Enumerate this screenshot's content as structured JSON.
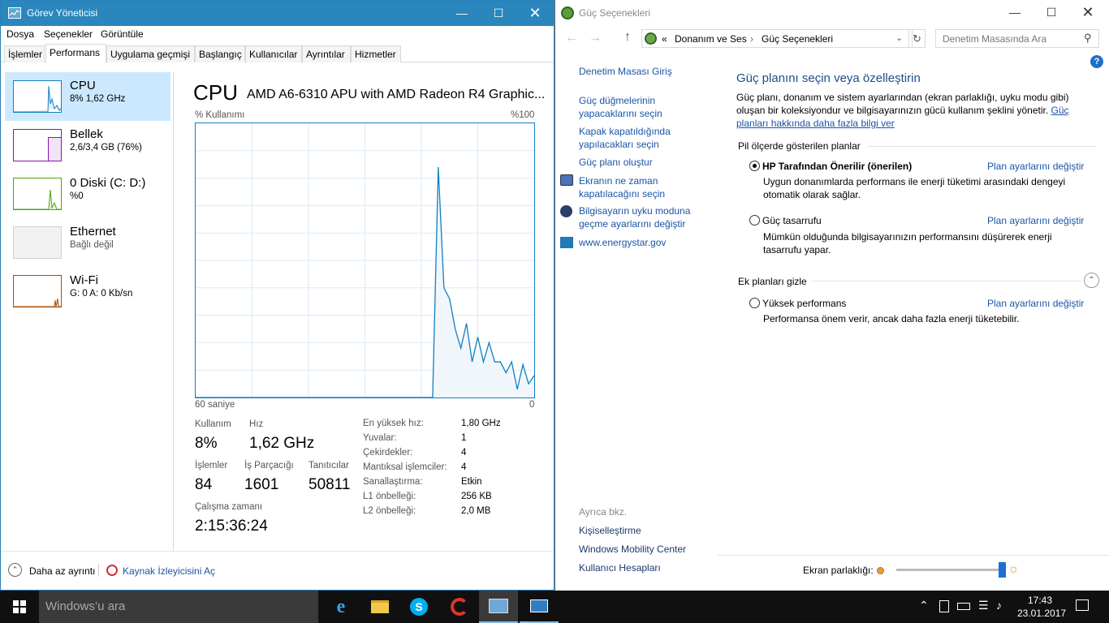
{
  "task_manager": {
    "title": "Görev Yöneticisi",
    "menu": [
      "Dosya",
      "Seçenekler",
      "Görüntüle"
    ],
    "tabs": [
      "İşlemler",
      "Performans",
      "Uygulama geçmişi",
      "Başlangıç",
      "Kullanıcılar",
      "Ayrıntılar",
      "Hizmetler"
    ],
    "active_tab": "Performans",
    "side_items": [
      {
        "name": "CPU",
        "sub": "8% 1,62 GHz",
        "color": "#1180c0"
      },
      {
        "name": "Bellek",
        "sub": "2,6/3,4 GB (76%)",
        "color": "#8b12ae"
      },
      {
        "name": "0 Diski (C: D:)",
        "sub": "%0",
        "color": "#4da60c"
      },
      {
        "name": "Ethernet",
        "sub": "Bağlı değil",
        "color": "#a0a0a0"
      },
      {
        "name": "Wi-Fi",
        "sub": "G: 0 A: 0 Kb/sn",
        "color": "#a74f01"
      }
    ],
    "header": {
      "title": "CPU",
      "model": "AMD A6-6310 APU with AMD Radeon R4 Graphic..."
    },
    "graph": {
      "label_left": "% Kullanımı",
      "label_right": "%100",
      "x_left": "60 saniye",
      "x_right": "0"
    },
    "stats": {
      "usage_label": "Kullanım",
      "usage_value": "8%",
      "speed_label": "Hız",
      "speed_value": "1,62 GHz",
      "processes_label": "İşlemler",
      "processes_value": "84",
      "threads_label": "İş Parçacığı",
      "threads_value": "1601",
      "handles_label": "Tanıtıcılar",
      "handles_value": "50811",
      "uptime_label": "Çalışma zamanı",
      "uptime_value": "2:15:36:24"
    },
    "details": [
      {
        "label": "En yüksek hız:",
        "value": "1,80 GHz"
      },
      {
        "label": "Yuvalar:",
        "value": "1"
      },
      {
        "label": "Çekirdekler:",
        "value": "4"
      },
      {
        "label": "Mantıksal işlemciler:",
        "value": "4"
      },
      {
        "label": "Sanallaştırma:",
        "value": "Etkin"
      },
      {
        "label": "L1 önbelleği:",
        "value": "256 KB"
      },
      {
        "label": "L2 önbelleği:",
        "value": "2,0 MB"
      }
    ],
    "footer": {
      "less_details": "Daha az ayrıntı",
      "resource_monitor": "Kaynak İzleyicisini Aç"
    }
  },
  "chart_data": {
    "type": "area",
    "xlabel": "60 saniye",
    "ylabel": "% Kullanımı",
    "ylim": [
      0,
      100
    ],
    "x": [
      0,
      1,
      2,
      3,
      4,
      5,
      6,
      7,
      8,
      9,
      10,
      11,
      12,
      13,
      14,
      15,
      16,
      17,
      18,
      19,
      20,
      21,
      22,
      23,
      24,
      25,
      26,
      27,
      28,
      29,
      30,
      31,
      32,
      33,
      34,
      35,
      36,
      37,
      38,
      39,
      40,
      41,
      42,
      43,
      44,
      45,
      46,
      47,
      48,
      49,
      50,
      51,
      52,
      53,
      54,
      55,
      56,
      57,
      58,
      59,
      60
    ],
    "values": [
      0,
      0,
      0,
      0,
      0,
      0,
      0,
      0,
      0,
      0,
      0,
      0,
      0,
      0,
      0,
      0,
      0,
      0,
      0,
      0,
      0,
      0,
      0,
      0,
      0,
      0,
      0,
      0,
      0,
      0,
      0,
      0,
      0,
      0,
      0,
      0,
      0,
      0,
      0,
      0,
      0,
      0,
      0,
      84,
      40,
      36,
      25,
      18,
      27,
      13,
      22,
      13,
      20,
      13,
      13,
      9,
      13,
      3,
      12,
      5,
      8
    ],
    "color": "#1180c0"
  },
  "power_options": {
    "title": "Güç Seçenekleri",
    "breadcrumb": [
      "«",
      "Donanım ve Ses",
      "Güç Seçenekleri"
    ],
    "search_placeholder": "Denetim Masasında Ara",
    "sidebar_links": [
      "Denetim Masası Giriş",
      "Güç düğmelerinin yapacaklarını seçin",
      "Kapak kapatıldığında yapılacakları seçin",
      "Güç planı oluştur",
      "Ekranın ne zaman kapatılacağını seçin",
      "Bilgisayarın uyku moduna geçme ayarlarını değiştir",
      "www.energystar.gov"
    ],
    "see_also": "Ayrıca bkz.",
    "see_also_links": [
      "Kişiselleştirme",
      "Windows Mobility Center",
      "Kullanıcı Hesapları"
    ],
    "heading": "Güç planını seçin veya özelleştirin",
    "intro": "Güç planı, donanım ve sistem ayarlarından (ekran parlaklığı, uyku modu gibi) oluşan bir koleksiyondur ve bilgisayarınızın gücü kullanım şeklini yönetir.",
    "intro_link": "Güç planları hakkında daha fazla bilgi ver",
    "section1": "Pil ölçerde gösterilen planlar",
    "plans": [
      {
        "name": "HP Tarafından Önerilir (önerilen)",
        "desc": "Uygun donanımlarda performans ile enerji tüketimi arasındaki dengeyi otomatik olarak sağlar.",
        "selected": true
      },
      {
        "name": "Güç tasarrufu",
        "desc": "Mümkün olduğunda bilgisayarınızın performansını düşürerek enerji tasarrufu yapar.",
        "selected": false
      }
    ],
    "section2": "Ek planları gizle",
    "extra_plan": {
      "name": "Yüksek performans",
      "desc": "Performansa önem verir, ancak daha fazla enerji tüketebilir.",
      "selected": false
    },
    "change_link": "Plan ayarlarını değiştir",
    "brightness_label": "Ekran parlaklığı:",
    "brightness_level": 0.97
  },
  "taskbar": {
    "search_placeholder": "Windows’u ara",
    "time": "17:43",
    "date": "23.01.2017"
  }
}
